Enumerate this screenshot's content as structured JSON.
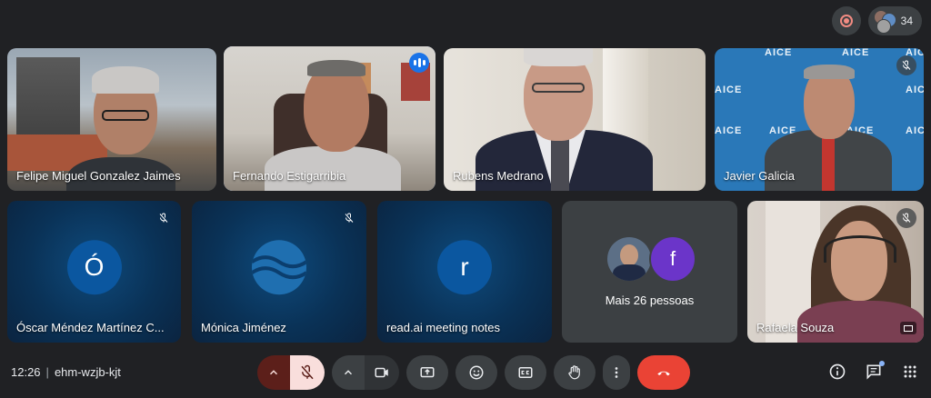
{
  "top_right": {
    "participant_count": "34"
  },
  "tiles": [
    {
      "name": "Felipe Miguel Gonzalez Jaimes"
    },
    {
      "name": "Fernando Estigarribia"
    },
    {
      "name": "Rubens Medrano"
    },
    {
      "name": "Javier Galicia",
      "background_text": "AICE"
    },
    {
      "name": "Óscar Méndez Martínez C...",
      "initial": "Ó"
    },
    {
      "name": "Mónica Jiménez"
    },
    {
      "name": "read.ai meeting notes",
      "initial": "r"
    },
    {
      "name": "Mais 26 pessoas",
      "initial": "f"
    },
    {
      "name": "Rafaela Souza"
    }
  ],
  "footer": {
    "time": "12:26",
    "meeting_code": "ehm-wzjb-kjt"
  },
  "colors": {
    "background": "#202124",
    "end_call": "#ea4335",
    "speaking_outline": "#a8c7fa",
    "mic_off_bg": "#f9dedc"
  },
  "icons": [
    "record-icon",
    "people-icon",
    "mic-off-icon",
    "chevron-up-icon",
    "camera-icon",
    "present-icon",
    "emoji-icon",
    "captions-icon",
    "raise-hand-icon",
    "more-vert-icon",
    "end-call-icon",
    "info-icon",
    "chat-icon",
    "apps-icon"
  ]
}
